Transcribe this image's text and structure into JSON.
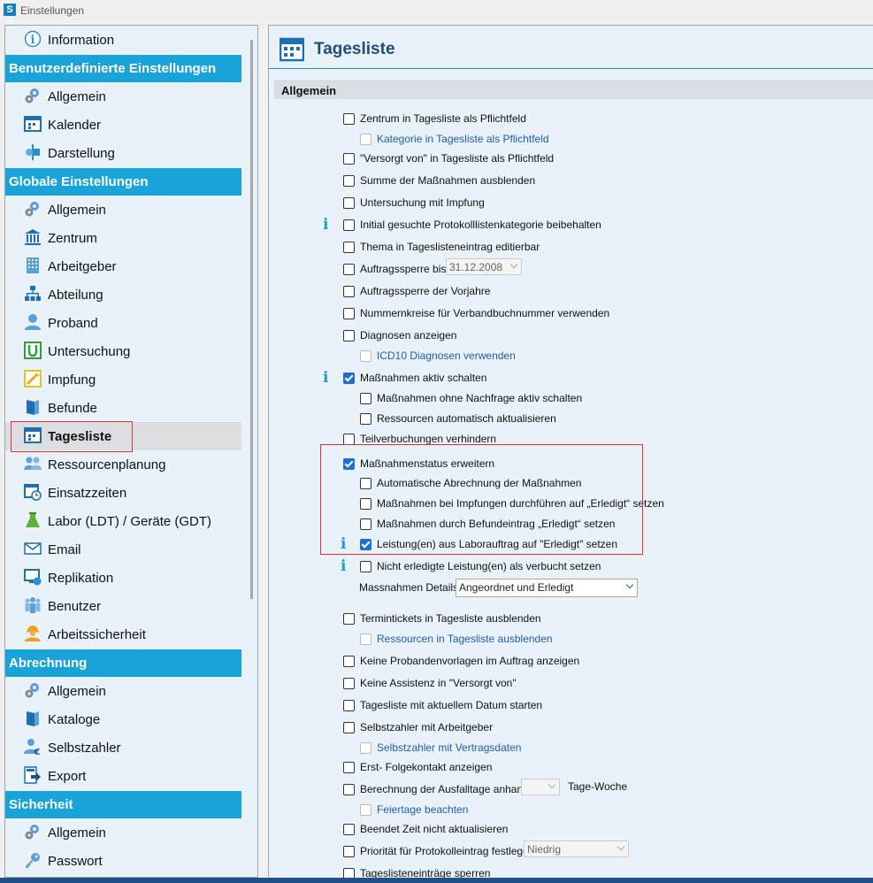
{
  "window": {
    "title": "Einstellungen",
    "app_icon": "S"
  },
  "sidebar": {
    "info_item": "Information",
    "sections": [
      {
        "header": "Benutzerdefinierte Einstellungen",
        "items": [
          {
            "label": "Allgemein",
            "icon": "gears-icon"
          },
          {
            "label": "Kalender",
            "icon": "calendar-icon"
          },
          {
            "label": "Darstellung",
            "icon": "display-icon"
          }
        ]
      },
      {
        "header": "Globale Einstellungen",
        "items": [
          {
            "label": "Allgemein",
            "icon": "gears-icon"
          },
          {
            "label": "Zentrum",
            "icon": "building-icon"
          },
          {
            "label": "Arbeitgeber",
            "icon": "office-icon"
          },
          {
            "label": "Abteilung",
            "icon": "orgchart-icon"
          },
          {
            "label": "Proband",
            "icon": "person-icon"
          },
          {
            "label": "Untersuchung",
            "icon": "exam-icon"
          },
          {
            "label": "Impfung",
            "icon": "syringe-icon"
          },
          {
            "label": "Befunde",
            "icon": "folder-icon"
          },
          {
            "label": "Tagesliste",
            "icon": "calendar-icon",
            "selected": true
          },
          {
            "label": "Ressourcenplanung",
            "icon": "people-icon"
          },
          {
            "label": "Einsatzzeiten",
            "icon": "clock-calendar-icon"
          },
          {
            "label": "Labor (LDT) / Geräte (GDT)",
            "icon": "flask-icon"
          },
          {
            "label": "Email",
            "icon": "envelope-icon"
          },
          {
            "label": "Replikation",
            "icon": "replication-icon"
          },
          {
            "label": "Benutzer",
            "icon": "users-icon"
          },
          {
            "label": "Arbeitssicherheit",
            "icon": "worker-icon"
          }
        ]
      },
      {
        "header": "Abrechnung",
        "items": [
          {
            "label": "Allgemein",
            "icon": "gears-icon"
          },
          {
            "label": "Kataloge",
            "icon": "book-icon"
          },
          {
            "label": "Selbstzahler",
            "icon": "person-euro-icon"
          },
          {
            "label": "Export",
            "icon": "export-icon"
          }
        ]
      },
      {
        "header": "Sicherheit",
        "items": [
          {
            "label": "Allgemein",
            "icon": "gears-icon"
          },
          {
            "label": "Passwort",
            "icon": "key-icon"
          }
        ]
      }
    ]
  },
  "main": {
    "title": "Tagesliste",
    "section": "Allgemein",
    "options": [
      {
        "label": "Zentrum in Tagesliste als Pflichtfeld",
        "checked": false
      },
      {
        "label": "Kategorie in Tagesliste als Pflichtfeld",
        "checked": false,
        "disabled": true,
        "indent": 1
      },
      {
        "label": "\"Versorgt von\" in Tagesliste als Pflichtfeld",
        "checked": false
      },
      {
        "label": "Summe der Maßnahmen ausblenden",
        "checked": false
      },
      {
        "label": "Untersuchung mit Impfung",
        "checked": false
      },
      {
        "label": "Initial gesuchte Protokolllistenkategorie beibehalten",
        "checked": false,
        "info": true
      },
      {
        "label": "Thema in Tageslisteneintrag editierbar",
        "checked": false
      },
      {
        "label": "Auftragssperre bis",
        "checked": false,
        "date": "31.12.2008"
      },
      {
        "label": "Auftragssperre der Vorjahre",
        "checked": false
      },
      {
        "label": "Nummernkreise für Verbandbuchnummer verwenden",
        "checked": false
      },
      {
        "label": "Diagnosen anzeigen",
        "checked": false
      },
      {
        "label": "ICD10 Diagnosen verwenden",
        "checked": false,
        "disabled": true,
        "indent": 1
      },
      {
        "label": "Maßnahmen aktiv schalten",
        "checked": true,
        "info": true
      },
      {
        "label": "Maßnahmen ohne Nachfrage aktiv schalten",
        "checked": false,
        "indent": 1
      },
      {
        "label": "Ressourcen automatisch aktualisieren",
        "checked": false,
        "indent": 1
      },
      {
        "label": "Teilverbuchungen verhindern",
        "checked": false
      },
      {
        "label": "Maßnahmenstatus erweitern",
        "checked": true
      },
      {
        "label": "Automatische Abrechnung der Maßnahmen",
        "checked": false,
        "indent": 1
      },
      {
        "label": "Maßnahmen bei Impfungen durchführen auf „Erledigt“ setzen",
        "checked": false,
        "indent": 1
      },
      {
        "label": "Maßnahmen durch Befundeintrag „Erledigt“ setzen",
        "checked": false,
        "indent": 1
      },
      {
        "label": "Leistung(en) aus Laborauftrag auf \"Erledigt\" setzen",
        "checked": true,
        "indent": 1,
        "info": true
      },
      {
        "label": "Nicht erledigte Leistung(en) als verbucht setzen",
        "checked": false,
        "indent": 1,
        "info": true
      },
      {
        "label": "Termintickets in Tagesliste ausblenden",
        "checked": false
      },
      {
        "label": "Ressourcen in Tagesliste ausblenden",
        "checked": false,
        "disabled": true,
        "indent": 1
      },
      {
        "label": "Keine Probandenvorlagen im Auftrag anzeigen",
        "checked": false
      },
      {
        "label": "Keine Assistenz in \"Versorgt von\"",
        "checked": false
      },
      {
        "label": "Tagesliste mit aktuellem Datum starten",
        "checked": false
      },
      {
        "label": "Selbstzahler mit Arbeitgeber",
        "checked": false
      },
      {
        "label": "Selbstzahler mit Vertragsdaten",
        "checked": false,
        "disabled": true,
        "indent": 1
      },
      {
        "label": "Erst- Folgekontakt anzeigen",
        "checked": false
      },
      {
        "label": "Berechnung der Ausfalltage anhand",
        "checked": false,
        "suffix": "Tage-Woche"
      },
      {
        "label": "Feiertage beachten",
        "checked": false,
        "disabled": true,
        "indent": 1
      },
      {
        "label": "Beendet Zeit nicht aktualisieren",
        "checked": false
      },
      {
        "label": "Priorität für Protokolleintrag festlegen",
        "checked": false,
        "priority": "Niedrig"
      },
      {
        "label": "Tageslisteneinträge sperren",
        "checked": false
      }
    ],
    "massnahmen_details": {
      "label": "Massnahmen Details",
      "value": "Angeordnet und Erledigt"
    }
  },
  "colors": {
    "accent": "#19a3d8",
    "panel_bg": "#e9f1f9",
    "title": "#1e4e79",
    "highlight": "#d33333"
  }
}
